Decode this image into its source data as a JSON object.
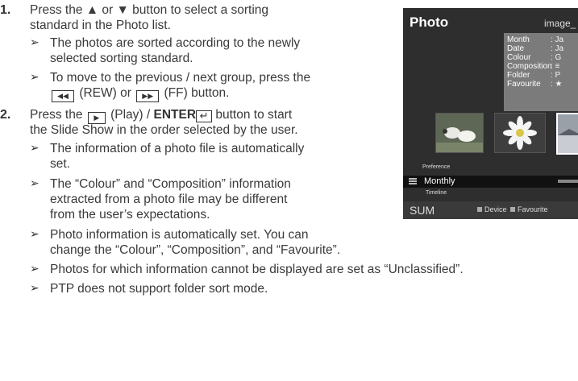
{
  "steps": [
    {
      "number": "1.",
      "lines": [
        "Press the ▲ or ▼ button to select a sorting",
        "standard in the Photo list."
      ],
      "notes": [
        {
          "lines": [
            "The photos are sorted according to the newly",
            "selected sorting standard."
          ]
        },
        {
          "lines": [
            "To move to the previous / next group, press the"
          ],
          "rew_label": "(REW) or",
          "ff_label": "(FF) button."
        }
      ]
    },
    {
      "number": "2.",
      "line1_pre": "Press the",
      "line1_play": "(Play) /",
      "line1_enter": "ENTER",
      "line1_post": "button to start",
      "line2": "the Slide Show in the order selected by the user.",
      "notes": [
        {
          "lines": [
            "The information of a photo file is automatically",
            "set."
          ]
        },
        {
          "lines": [
            "The “Colour” and “Composition” information",
            "extracted from a photo file may be different",
            "from the user’s expectations."
          ]
        },
        {
          "lines": [
            "Photo information is automatically set. You can",
            "change the “Colour”, “Composition”, and “Favourite”."
          ]
        },
        {
          "lines": [
            "Photos for which information cannot be displayed are set as “Unclassified”."
          ]
        },
        {
          "lines": [
            "PTP does not support folder sort mode."
          ]
        }
      ]
    }
  ],
  "note_arrow": "➢",
  "tv": {
    "title": "Photo",
    "filename": "image_",
    "info_rows": [
      {
        "label": "Month",
        "value": ": Ja"
      },
      {
        "label": "Date",
        "value": ": Ja"
      },
      {
        "label": "Colour",
        "value": ": G"
      },
      {
        "label": "Composition",
        "value": ": ≡"
      },
      {
        "label": "Folder",
        "value": ": P"
      },
      {
        "label": "Favourite",
        "value": ": ★"
      }
    ],
    "preference_label": "Preference",
    "sort_selected": "Monthly",
    "timeline_label": "Timeline",
    "sum_label": "SUM",
    "legend": [
      "Device",
      "Favourite"
    ]
  }
}
